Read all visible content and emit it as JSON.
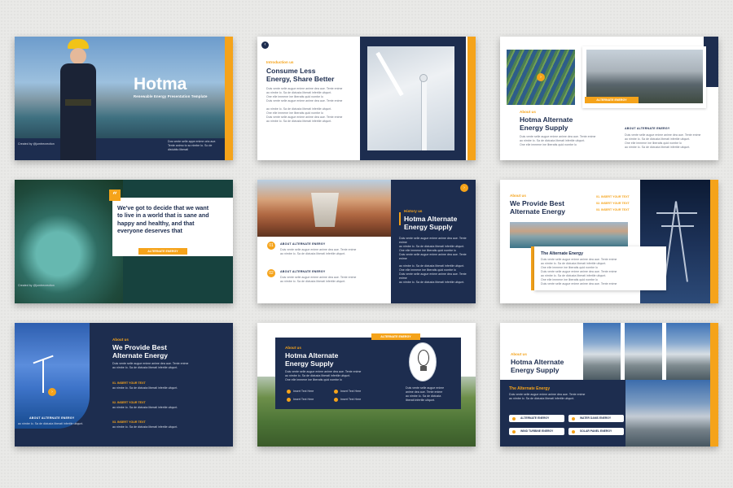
{
  "colors": {
    "navy": "#1d2d4f",
    "orange": "#f5a31a",
    "background": "#e9e9e7"
  },
  "lorem": {
    "line1": "Duis vente selle augue enime anime dea aue. Tente enime",
    "line2": "ao nimbe lo. Sa de dictusta liberati infertile uitqunt.",
    "line3": "One elle immene ine liberatis quid nombe lo"
  },
  "slide1": {
    "title": "Hotma",
    "subtitle": "Renewable Energy Presentation Template",
    "credit": "Created by @jumtrecrection",
    "body": "Dos vente selle appe enime oria aue. Tente animo to so nimbe lo. So de distubito liberati"
  },
  "slide2": {
    "label": "Introduction us",
    "title_line1": "Consume Less",
    "title_line2": "Energy, Share Better",
    "back_icon": "chevron-left-icon"
  },
  "slide3": {
    "label": "About us",
    "title_line1": "Hotma Alternate",
    "title_line2": "Energy Supply",
    "button": "ALTERNATE ENERGY",
    "side_heading": "ABOUT ALTERNATE ENERGY"
  },
  "slide4": {
    "quote_icon": "quote-icon",
    "quote": "We've got to decide that we want to live in a world that is sane and happy and healthy, and that everyone deserves that",
    "button": "ALTERNATE ENERGY",
    "credit": "Created by @jumtrecrection"
  },
  "slide5": {
    "label": "History us",
    "title_line1": "Hotma Alternate",
    "title_line2": "Energy Supply",
    "item1": "ABOUT ALTERNATE ENERGY",
    "item2": "ABOUT ALTERNATE ENERGY",
    "n1": "01",
    "n2": "02"
  },
  "slide6": {
    "label": "About us",
    "title_line1": "We Provide Best",
    "title_line2": "Alternate Energy",
    "insert1": "01. INSERT YOUR TEXT",
    "insert2": "02. INSERT YOUR TEXT",
    "insert3": "03. INSERT YOUR TEXT",
    "card_title": "The Alternate Energy"
  },
  "slide7": {
    "label": "About us",
    "title_line1": "We Provide Best",
    "title_line2": "Alternate Energy",
    "insert1": "01. INSERT YOUR TEXT",
    "insert2": "02. INSERT YOUR TEXT",
    "insert3": "03. INSERT YOUR TEXT",
    "image_caption": "ABOUT ALTERNATE ENERGY"
  },
  "slide8": {
    "tag": "ALTERNATE ENERGY",
    "label": "About us",
    "title_line1": "Hotma Alternate",
    "title_line2": "Energy Supply",
    "b1": "Insert Text Here",
    "b2": "Insert Text Here",
    "b3": "Insert Text Here",
    "b4": "Insert Text Here"
  },
  "slide9": {
    "label": "About us",
    "title_line1": "Hotma Alternate",
    "title_line2": "Energy Supply",
    "panel_title": "The Alternate Energy",
    "p1": "ALTERNATE ENERGY",
    "p2": "WATER DAMS ENERGY",
    "p3": "WIND TURBINE ENERGY",
    "p4": "SOLAR PANEL ENERGY"
  }
}
